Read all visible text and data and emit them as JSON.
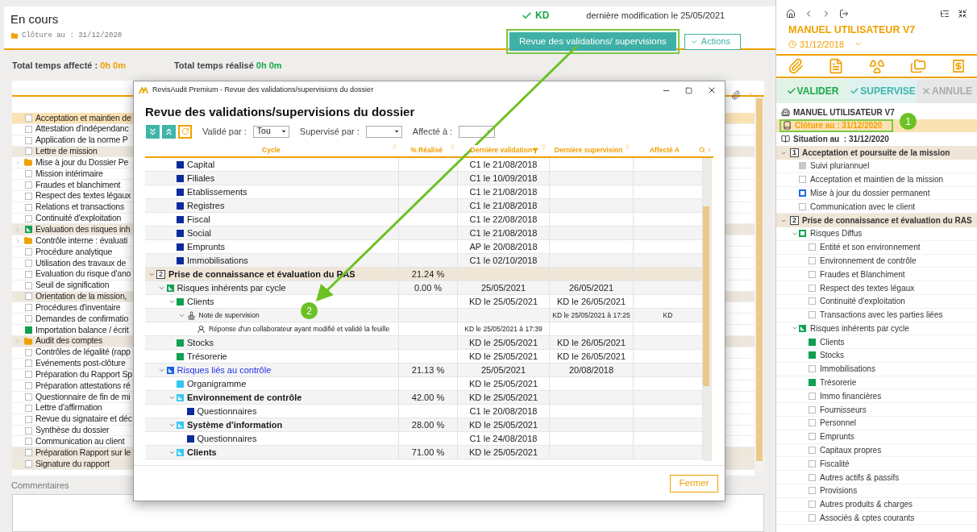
{
  "header": {
    "status": "En cours",
    "closing": "Clôture au : 31/12/2020",
    "validator": "KD",
    "last_modified": "dernière modification le 25/05/2021",
    "review_button": {
      "label": "Revue des validations/ supervisions",
      "highlighted": true
    },
    "actions_button": "Actions"
  },
  "totals": [
    {
      "label": "Total temps affecté :",
      "value": "0h 0m",
      "color": "#f0a000"
    },
    {
      "label": "Total temps réalisé",
      "value": "0h 0m",
      "color": "#1aa84a"
    }
  ],
  "task_list": [
    {
      "label": "Acceptation et maintien de",
      "kind": "box",
      "selected": true,
      "shaded": false
    },
    {
      "label": "Attestation d'indépendanc",
      "kind": "box",
      "selected": false,
      "shaded": false
    },
    {
      "label": "Application de la norme P",
      "kind": "box",
      "selected": false,
      "shaded": false
    },
    {
      "label": "Lettre de mission",
      "kind": "box",
      "selected": false,
      "shaded": true
    },
    {
      "label": "Mise à jour du Dossier Pe",
      "kind": "folder",
      "selected": false,
      "shaded": false
    },
    {
      "label": "Mission intérimaire",
      "kind": "box",
      "selected": false,
      "shaded": false
    },
    {
      "label": "Fraudes et blanchiment",
      "kind": "box",
      "selected": false,
      "shaded": false
    },
    {
      "label": "Respect des textes légaux",
      "kind": "box",
      "selected": false,
      "shaded": false
    },
    {
      "label": "Relations et transactions",
      "kind": "box",
      "selected": false,
      "shaded": false
    },
    {
      "label": "Continuité d'exploitation",
      "kind": "box",
      "selected": false,
      "shaded": false
    },
    {
      "label": "Evaluation des risques inh",
      "kind": "diag",
      "selected": false,
      "shaded": true
    },
    {
      "label": "Contrôle interne : évaluati",
      "kind": "folder",
      "selected": false,
      "shaded": false
    },
    {
      "label": "Procédure analytique",
      "kind": "box",
      "selected": false,
      "shaded": false
    },
    {
      "label": "Utilisation des travaux de",
      "kind": "box",
      "selected": false,
      "shaded": false
    },
    {
      "label": "Evaluation du risque d'ano",
      "kind": "box",
      "selected": false,
      "shaded": false
    },
    {
      "label": "Seuil de signification",
      "kind": "box",
      "selected": false,
      "shaded": false
    },
    {
      "label": "Orientation de la mission,",
      "kind": "box",
      "selected": false,
      "shaded": true
    },
    {
      "label": "Procédures d'inventaire",
      "kind": "box",
      "selected": false,
      "shaded": false
    },
    {
      "label": "Demandes de confirmatio",
      "kind": "box",
      "selected": false,
      "shaded": false
    },
    {
      "label": "Importation balance / écrit",
      "kind": "filled",
      "selected": false,
      "shaded": false
    },
    {
      "label": "Audit des comptes",
      "kind": "folder",
      "selected": false,
      "shaded": true
    },
    {
      "label": "Contrôles de légalité (rapp",
      "kind": "box",
      "selected": false,
      "shaded": false
    },
    {
      "label": "Evénements post-clôture",
      "kind": "box",
      "selected": false,
      "shaded": false
    },
    {
      "label": "Préparation du Rapport Sp",
      "kind": "box",
      "selected": false,
      "shaded": false
    },
    {
      "label": "Préparation attestations ré",
      "kind": "box",
      "selected": false,
      "shaded": false
    },
    {
      "label": "Questionnaire de fin de mi",
      "kind": "box",
      "selected": false,
      "shaded": false
    },
    {
      "label": "Lettre d'affirmation",
      "kind": "box",
      "selected": false,
      "shaded": false
    },
    {
      "label": "Revue du signataire et déc",
      "kind": "box",
      "selected": false,
      "shaded": false
    },
    {
      "label": "Synthèse du dossier",
      "kind": "box",
      "selected": false,
      "shaded": false
    },
    {
      "label": "Communication au client",
      "kind": "box",
      "selected": false,
      "shaded": false
    },
    {
      "label": "Préparation Rapport sur le",
      "kind": "box",
      "selected": false,
      "shaded": true
    },
    {
      "label": "Signature du rapport",
      "kind": "box",
      "selected": false,
      "shaded": true
    }
  ],
  "comments": {
    "label": "Commentaires"
  },
  "dialog": {
    "window_title": "RevisAudit Premium - Revue des validations/supervisions du dossier",
    "heading": "Revue des validations/supervisions du dossier",
    "filters": [
      {
        "label": "Validé par :",
        "value": "Tou"
      },
      {
        "label": "Supervisé par :"
      },
      {
        "label": "Affecté à :"
      }
    ],
    "table": {
      "columns": [
        {
          "label": "Cycle",
          "sortable": true,
          "filtered": false
        },
        {
          "label": "% Réalisé",
          "sortable": true,
          "filtered": false
        },
        {
          "label": "Dernière validation",
          "sortable": true,
          "filtered": true
        },
        {
          "label": "Dernière supervision",
          "sortable": true,
          "filtered": false
        },
        {
          "label": "Affecté A",
          "sortable": false,
          "filtered": false
        }
      ],
      "continued_rows": [
        {
          "label": "Capital",
          "kind": "item",
          "color": "#0b2a9c",
          "selected": false,
          "expanded": false,
          "validation": "C1 le 21/08/2018"
        },
        {
          "label": "Filiales",
          "kind": "item",
          "color": "#0b2a9c",
          "selected": false,
          "expanded": false,
          "validation": "C1 le 10/09/2018"
        },
        {
          "label": "Etablissements",
          "kind": "item",
          "color": "#0b2a9c",
          "selected": false,
          "expanded": false,
          "validation": "C1 le 21/08/2018"
        },
        {
          "label": "Registres",
          "kind": "item",
          "color": "#0b2a9c",
          "selected": false,
          "expanded": false,
          "validation": "C1 le 21/08/2018"
        },
        {
          "label": "Fiscal",
          "kind": "item",
          "color": "#0b2a9c",
          "selected": false,
          "expanded": false,
          "validation": "C1 le 22/08/2018"
        },
        {
          "label": "Social",
          "kind": "item",
          "color": "#0b2a9c",
          "selected": false,
          "expanded": false,
          "validation": "C1 le 21/08/2018"
        },
        {
          "label": "Emprunts",
          "kind": "item",
          "color": "#0b2a9c",
          "selected": false,
          "expanded": false,
          "validation": "AP le 20/08/2018"
        },
        {
          "label": "Immobilisations",
          "kind": "item",
          "color": "#0b2a9c",
          "selected": false,
          "expanded": false,
          "validation": "C1 le 02/10/2018"
        }
      ],
      "rows": [
        {
          "number": "2",
          "label": "Prise de connaissance et évaluation du RAS",
          "kind": "section",
          "selected": false,
          "expanded": true,
          "realise": "21.24 %",
          "children": [
            {
              "label": "Risques inhérents par cycle",
              "kind": "group",
              "color": "#10a050",
              "selected": false,
              "expanded": true,
              "realise": "0.00 %",
              "validation": "25/05/2021",
              "supervision": "26/05/2021",
              "children": [
                {
                  "label": "Clients",
                  "kind": "item",
                  "color": "#10a050",
                  "selected": false,
                  "expanded": true,
                  "validation": "KD le 25/05/2021",
                  "supervision": "KD le 26/05/2021",
                  "children": [
                    {
                      "label": "Note de supervision",
                      "kind": "note",
                      "selected": false,
                      "expanded": true,
                      "supervision": "KD le 25/05/2021 à 17:25",
                      "affecte": "KD",
                      "children": [
                        {
                          "label": "Réponse d'un collaborateur ayant modifié et validé la feuille",
                          "kind": "reply",
                          "selected": false,
                          "expanded": false,
                          "validation": "KD le 25/05/2021 à 17:39"
                        }
                      ]
                    }
                  ]
                },
                {
                  "label": "Stocks",
                  "kind": "item",
                  "color": "#10a050",
                  "selected": false,
                  "expanded": false,
                  "validation": "KD le 25/05/2021",
                  "supervision": "KD le 26/05/2021"
                },
                {
                  "label": "Trésorerie",
                  "kind": "item",
                  "color": "#10a050",
                  "selected": false,
                  "expanded": false,
                  "validation": "KD le 25/05/2021",
                  "supervision": "KD le 26/05/2021"
                }
              ]
            },
            {
              "label": "Risques liés au contrôle",
              "kind": "group",
              "color": "#1560e0",
              "selected": true,
              "expanded": true,
              "realise": "21.13 %",
              "validation": "25/05/2021",
              "supervision": "20/08/2018",
              "children": [
                {
                  "label": "Organigramme",
                  "kind": "item",
                  "color": "#33c6f2",
                  "selected": false,
                  "expanded": false,
                  "validation": "KD le 25/05/2021"
                },
                {
                  "label": "Environnement de contrôle",
                  "kind": "subgroup",
                  "color": "#33c6f2",
                  "selected": false,
                  "expanded": true,
                  "realise": "42.00 %",
                  "validation": "KD le 25/05/2021",
                  "children": [
                    {
                      "label": "Questionnaires",
                      "kind": "item",
                      "color": "#0b2a9c",
                      "selected": false,
                      "expanded": false,
                      "validation": "C1 le 20/08/2018"
                    }
                  ]
                },
                {
                  "label": "Système d'information",
                  "kind": "subgroup",
                  "color": "#33c6f2",
                  "selected": false,
                  "expanded": true,
                  "realise": "28.00 %",
                  "validation": "KD le 25/05/2021",
                  "children": [
                    {
                      "label": "Questionnaires",
                      "kind": "item",
                      "color": "#0b2a9c",
                      "selected": false,
                      "expanded": false,
                      "validation": "C1 le 24/08/2018"
                    }
                  ]
                },
                {
                  "label": "Clients",
                  "kind": "subgroup",
                  "color": "#33c6f2",
                  "selected": false,
                  "expanded": true,
                  "realise": "71.00 %",
                  "validation": "KD le 25/05/2021"
                }
              ]
            }
          ]
        }
      ]
    },
    "close_button": "Fermer"
  },
  "side_panel": {
    "title": "MANUEL UTILISATEUR V7",
    "date": "31/12/2018",
    "actions": [
      {
        "label": "VALIDER",
        "kind": "validate"
      },
      {
        "label": "SUPERVISE",
        "kind": "supervise"
      },
      {
        "label": "ANNULE",
        "kind": "cancel"
      }
    ],
    "info": [
      {
        "label": "MANUEL UTILISATEUR V7",
        "kind": "building",
        "selected": false,
        "highlighted": false
      },
      {
        "label": "Clôture au : 31/12/2020",
        "kind": "book",
        "selected": true,
        "highlighted": true
      },
      {
        "label": "Situation au  : 31/12/2020",
        "kind": "open-book",
        "selected": false,
        "highlighted": false
      }
    ],
    "sections": [
      {
        "number": "1",
        "label": "Acceptation et poursuite de la mission",
        "expanded": true,
        "children": [
          {
            "label": "Suivi pluriannuel",
            "kind": "filled",
            "color": "#c8c8c8",
            "expanded": false
          },
          {
            "label": "Acceptation et maintien de la mission",
            "kind": "box",
            "expanded": false
          },
          {
            "label": "Mise à jour du dossier permanent",
            "kind": "outline",
            "color": "#1a6ee8",
            "expanded": false
          },
          {
            "label": "Communication avec le client",
            "kind": "box",
            "expanded": false
          }
        ]
      },
      {
        "number": "2",
        "label": "Prise de connaissance et évaluation du RAS",
        "expanded": true,
        "children": [
          {
            "label": "Risques Diffus",
            "kind": "outline",
            "color": "#10a84a",
            "expanded": true,
            "children": [
              {
                "label": "Entité et son environnement",
                "kind": "box",
                "expanded": false
              },
              {
                "label": "Environnement de contrôle",
                "kind": "box",
                "expanded": false
              },
              {
                "label": "Fraudes et Blanchiment",
                "kind": "box",
                "expanded": false
              },
              {
                "label": "Respect des textes légaux",
                "kind": "box",
                "expanded": false
              },
              {
                "label": "Continuité d'exploitation",
                "kind": "box",
                "expanded": false
              },
              {
                "label": "Transactions avec les parties liées",
                "kind": "box",
                "expanded": false
              }
            ]
          },
          {
            "label": "Risques inhérents par cycle",
            "kind": "diag",
            "color": "#10a050",
            "expanded": true,
            "children": [
              {
                "label": "Clients",
                "kind": "filled",
                "color": "#10a050",
                "expanded": false
              },
              {
                "label": "Stocks",
                "kind": "filled",
                "color": "#10a050",
                "expanded": false
              },
              {
                "label": "Immobilisations",
                "kind": "box",
                "expanded": false
              },
              {
                "label": "Trésorerie",
                "kind": "filled",
                "color": "#10a050",
                "expanded": false
              },
              {
                "label": "Immo financières",
                "kind": "box",
                "expanded": false
              },
              {
                "label": "Fournisseurs",
                "kind": "box",
                "expanded": false
              },
              {
                "label": "Personnel",
                "kind": "box",
                "expanded": false
              },
              {
                "label": "Emprunts",
                "kind": "box",
                "expanded": false
              },
              {
                "label": "Capitaux propres",
                "kind": "box",
                "expanded": false
              },
              {
                "label": "Fiscalité",
                "kind": "box",
                "expanded": false
              },
              {
                "label": "Autres actifs & passifs",
                "kind": "box",
                "expanded": false
              },
              {
                "label": "Provisions",
                "kind": "box",
                "expanded": false
              },
              {
                "label": "Autres produits & charges",
                "kind": "box",
                "expanded": false
              },
              {
                "label": "Associés & cptes courants",
                "kind": "box",
                "expanded": false
              }
            ]
          }
        ]
      }
    ]
  },
  "callouts": [
    {
      "label": "1"
    },
    {
      "label": "2"
    }
  ]
}
